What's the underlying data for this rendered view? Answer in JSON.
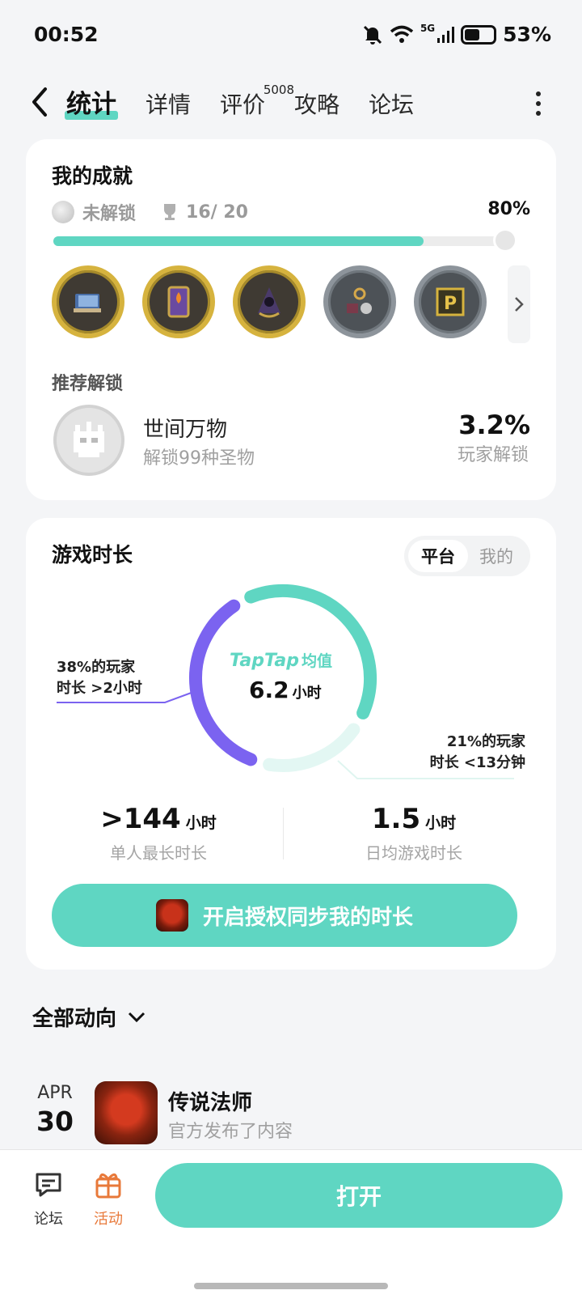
{
  "status_bar": {
    "time": "00:52",
    "network": "5G",
    "battery": "53%"
  },
  "tabs": [
    {
      "label": "统计",
      "active": true
    },
    {
      "label": "详情"
    },
    {
      "label": "评价",
      "badge": "5008"
    },
    {
      "label": "攻略"
    },
    {
      "label": "论坛"
    }
  ],
  "achievements": {
    "title": "我的成就",
    "locked_label": "未解锁",
    "progress_text": "16/ 20",
    "progress_percent_label": "80%",
    "progress_value": 0.8,
    "badges": [
      {
        "icon": "book-icon",
        "frame": "gold"
      },
      {
        "icon": "card-icon",
        "frame": "gold"
      },
      {
        "icon": "hooded-wizard-icon",
        "frame": "gold"
      },
      {
        "icon": "amulet-icon",
        "frame": "silver"
      },
      {
        "icon": "p-chest-icon",
        "frame": "silver"
      }
    ],
    "recommend_title": "推荐解锁",
    "recommend": {
      "name": "世间万物",
      "desc": "解锁99种圣物",
      "percent": "3.2%",
      "percent_label": "玩家解锁"
    }
  },
  "playtime": {
    "title": "游戏时长",
    "toggle": {
      "on": "平台",
      "off": "我的"
    },
    "brand": "TapTap",
    "brand_suffix": "均值",
    "average": "6.2",
    "unit": "小时",
    "note_left": [
      "38%的玩家",
      "时长 >2小时"
    ],
    "note_right": [
      "21%的玩家",
      "时长 <13分钟"
    ],
    "donut": {
      "over_2h": 0.38,
      "under_13m": 0.21
    },
    "stats": [
      {
        "value": ">144",
        "unit": "小时",
        "label": "单人最长时长"
      },
      {
        "value": "1.5",
        "unit": "小时",
        "label": "日均游戏时长"
      }
    ],
    "sync_button": "开启授权同步我的时长"
  },
  "feed": {
    "title": "全部动向",
    "items": [
      {
        "month": "APR",
        "day": "30",
        "game": "传说法师",
        "desc": "官方发布了内容"
      }
    ]
  },
  "bottom": {
    "forum": "论坛",
    "activity": "活动",
    "open": "打开"
  },
  "colors": {
    "accent": "#5fd6c2",
    "purple": "#7b63f0",
    "activity": "#e8793a"
  }
}
